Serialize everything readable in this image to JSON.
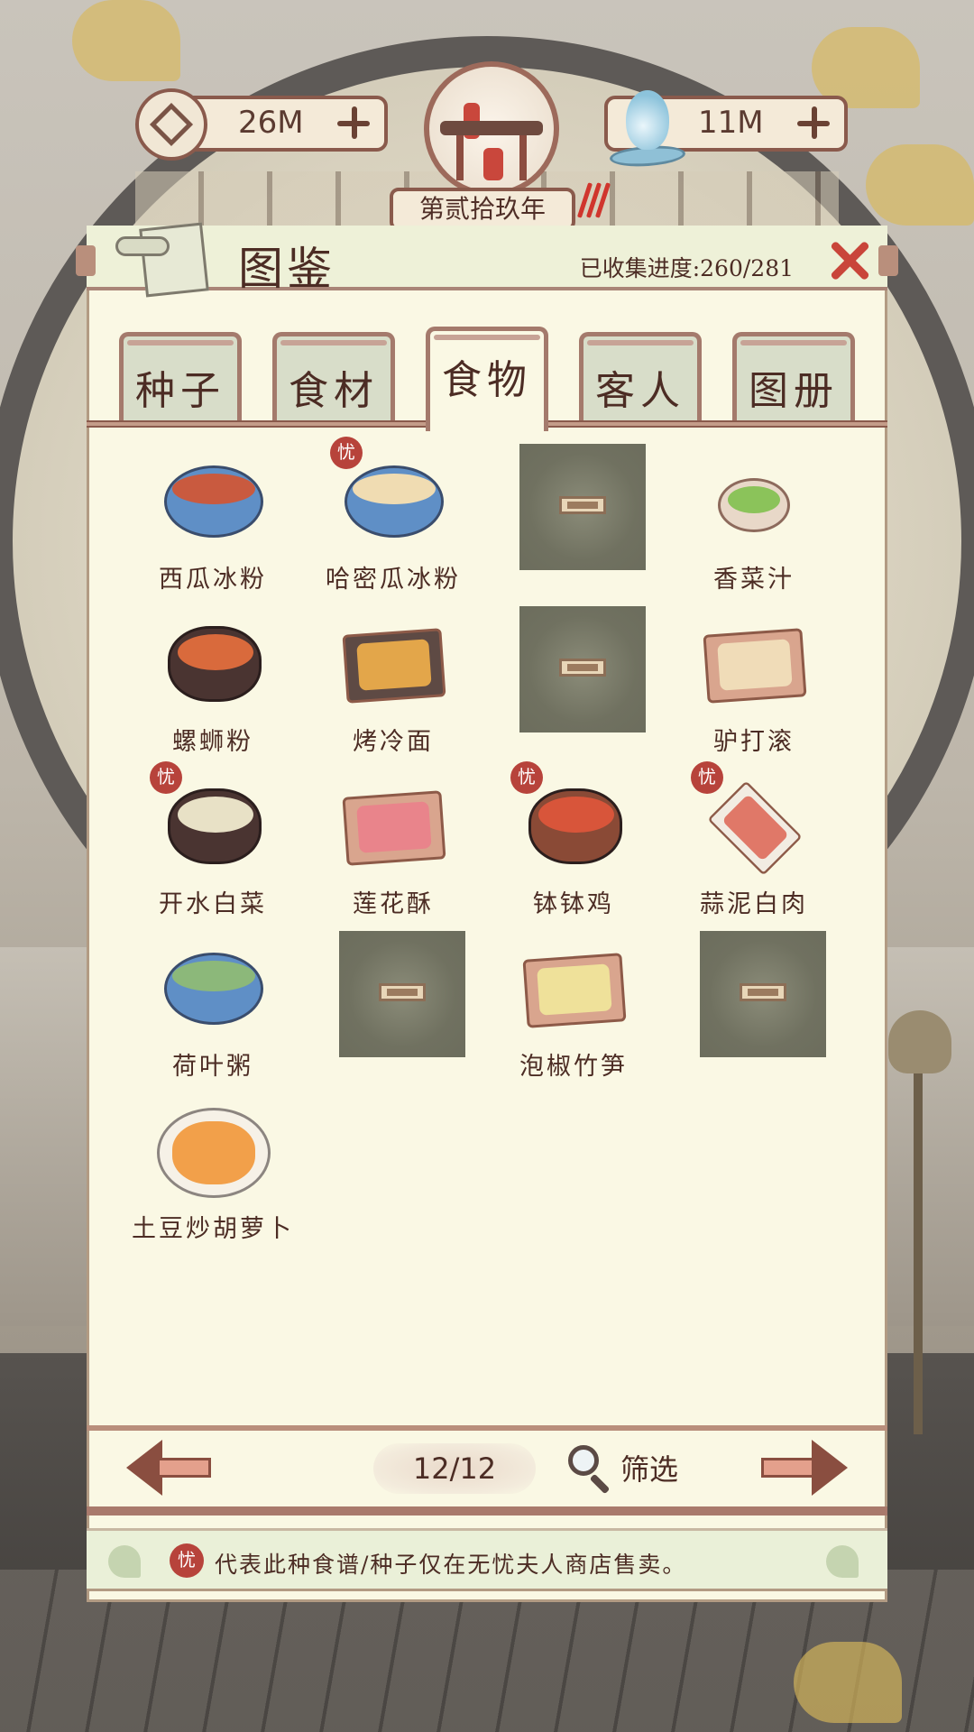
{
  "currency": {
    "coins": "26M",
    "water": "11M"
  },
  "year": "第贰拾玖年",
  "panel": {
    "title": "图鉴",
    "progress": "已收集进度:260/281"
  },
  "tabs": [
    "种子",
    "食材",
    "食物",
    "客人",
    "图册"
  ],
  "active_tab": "食物",
  "items": [
    {
      "name": "西瓜冰粉",
      "locked": false,
      "shop_only": false
    },
    {
      "name": "哈密瓜冰粉",
      "locked": false,
      "shop_only": true
    },
    {
      "name": "",
      "locked": true,
      "shop_only": false
    },
    {
      "name": "香菜汁",
      "locked": false,
      "shop_only": false
    },
    {
      "name": "螺蛳粉",
      "locked": false,
      "shop_only": false
    },
    {
      "name": "烤冷面",
      "locked": false,
      "shop_only": false
    },
    {
      "name": "",
      "locked": true,
      "shop_only": false
    },
    {
      "name": "驴打滚",
      "locked": false,
      "shop_only": false
    },
    {
      "name": "开水白菜",
      "locked": false,
      "shop_only": true
    },
    {
      "name": "莲花酥",
      "locked": false,
      "shop_only": false
    },
    {
      "name": "钵钵鸡",
      "locked": false,
      "shop_only": true
    },
    {
      "name": "蒜泥白肉",
      "locked": false,
      "shop_only": true
    },
    {
      "name": "荷叶粥",
      "locked": false,
      "shop_only": false
    },
    {
      "name": "",
      "locked": true,
      "shop_only": false
    },
    {
      "name": "泡椒竹笋",
      "locked": false,
      "shop_only": false
    },
    {
      "name": "",
      "locked": true,
      "shop_only": false
    },
    {
      "name": "土豆炒胡萝卜",
      "locked": false,
      "shop_only": false
    }
  ],
  "badge_label": "忧",
  "pager": {
    "page": "12/12"
  },
  "filter_label": "筛选",
  "note": "代表此种食谱/种子仅在无忧夫人商店售卖。",
  "colors": {
    "accent": "#8a5a4c",
    "badge": "#b7433b",
    "close": "#c9453a",
    "locked_tile": "#7a7b6c"
  }
}
